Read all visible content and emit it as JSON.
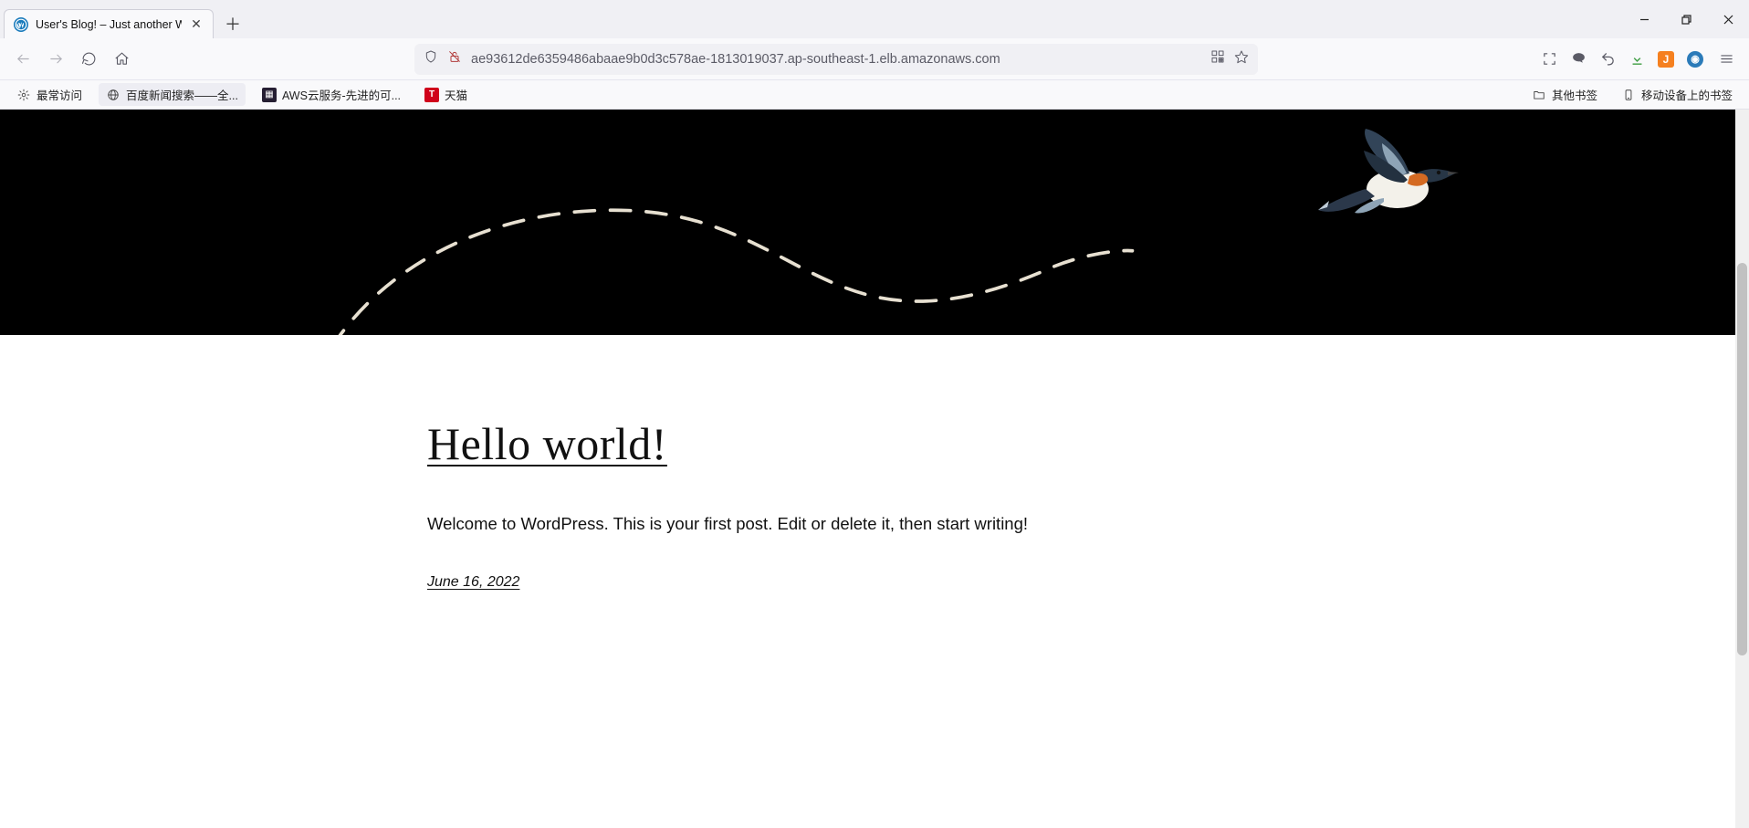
{
  "browser": {
    "tab_title": "User's Blog! – Just another W",
    "url": "ae93612de6359486abaae9b0d3c578ae-1813019037.ap-southeast-1.elb.amazonaws.com"
  },
  "bookmarks_bar": {
    "frequent_label": "最常访问",
    "items": [
      {
        "label": "百度新闻搜索——全..."
      },
      {
        "label": "AWS云服务-先进的可..."
      },
      {
        "label": "天猫"
      }
    ],
    "other_label": "其他书签",
    "mobile_label": "移动设备上的书签"
  },
  "post": {
    "title": "Hello world!",
    "body": "Welcome to WordPress. This is your first post. Edit or delete it, then start writing!",
    "date": "June 16, 2022"
  }
}
